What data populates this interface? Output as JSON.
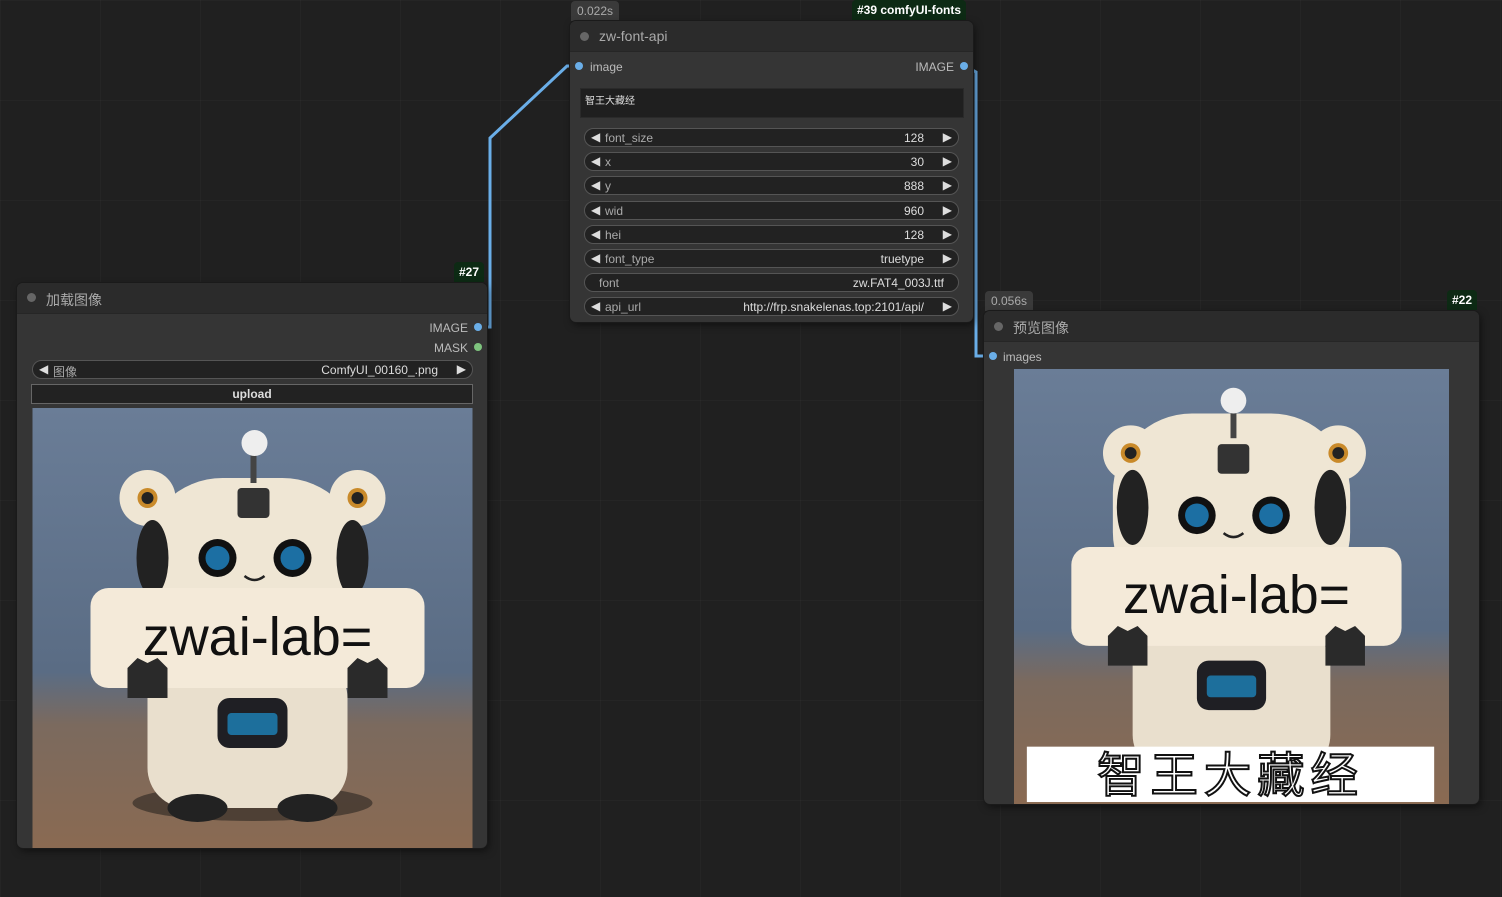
{
  "load_node": {
    "id_badge": "#27",
    "title": "加载图像",
    "outputs": [
      "IMAGE",
      "MASK"
    ],
    "image_widget": {
      "label": "图像",
      "value": "ComfyUI_00160_.png"
    },
    "upload_label": "upload",
    "sign_text": "zwai-lab="
  },
  "font_node": {
    "timing": "0.022s",
    "id_badge": "#39 comfyUI-fonts",
    "title": "zw-font-api",
    "input": "image",
    "output": "IMAGE",
    "text_value": "智王大藏经",
    "widgets": [
      {
        "label": "font_size",
        "value": "128"
      },
      {
        "label": "x",
        "value": "30"
      },
      {
        "label": "y",
        "value": "888"
      },
      {
        "label": "wid",
        "value": "960"
      },
      {
        "label": "hei",
        "value": "128"
      },
      {
        "label": "font_type",
        "value": "truetype"
      },
      {
        "label": "font",
        "value": "zw.FAT4_003J.ttf"
      },
      {
        "label": "api_url",
        "value": "http://frp.snakelenas.top:2101/api/"
      }
    ]
  },
  "preview_node": {
    "timing": "0.056s",
    "id_badge": "#22",
    "title": "预览图像",
    "input": "images",
    "sign_text": "zwai-lab=",
    "overlay_text": "智王大藏经"
  },
  "colors": {
    "link": "#6aaee8",
    "image_slot": "#6aaee8",
    "mask_slot": "#7ec47e",
    "badge_bg": "#0d2a14"
  }
}
